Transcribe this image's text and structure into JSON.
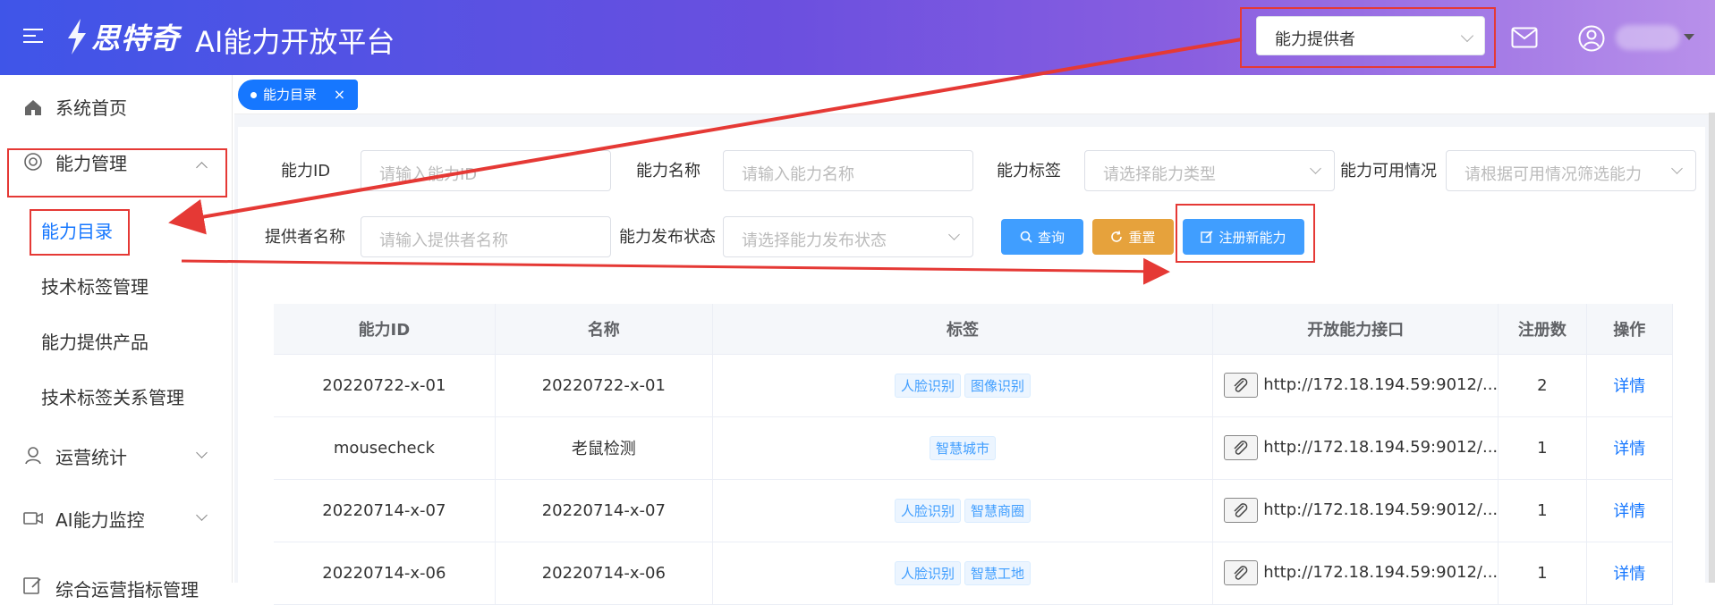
{
  "header": {
    "logo_text": "思特奇",
    "platform_title": "AI能力开放平台",
    "role_select_value": "能力提供者"
  },
  "sidebar": {
    "items": [
      {
        "label": "系统首页",
        "icon": "home-icon"
      },
      {
        "label": "能力管理",
        "icon": "capability-icon",
        "expanded": true
      },
      {
        "label": "运营统计",
        "icon": "stats-icon"
      },
      {
        "label": "AI能力监控",
        "icon": "monitor-icon"
      },
      {
        "label": "综合运营指标管理",
        "icon": "edit-icon"
      }
    ],
    "sub_items": [
      {
        "label": "能力目录",
        "active": true
      },
      {
        "label": "技术标签管理"
      },
      {
        "label": "能力提供产品"
      },
      {
        "label": "技术标签关系管理"
      }
    ]
  },
  "tabs": {
    "active_tab": "能力目录",
    "close_symbol": "×"
  },
  "filters": {
    "row1": [
      {
        "label": "能力ID",
        "placeholder": "请输入能力ID",
        "type": "input"
      },
      {
        "label": "能力名称",
        "placeholder": "请输入能力名称",
        "type": "input"
      },
      {
        "label": "能力标签",
        "placeholder": "请选择能力类型",
        "type": "select"
      },
      {
        "label": "能力可用情况",
        "placeholder": "请根据可用情况筛选能力",
        "type": "select"
      }
    ],
    "row2": [
      {
        "label": "提供者名称",
        "placeholder": "请输入提供者名称",
        "type": "input"
      },
      {
        "label": "能力发布状态",
        "placeholder": "请选择能力发布状态",
        "type": "select"
      }
    ],
    "buttons": {
      "query": "查询",
      "reset": "重置",
      "register": "注册新能力"
    }
  },
  "table": {
    "columns": [
      "能力ID",
      "名称",
      "标签",
      "开放能力接口",
      "注册数",
      "操作"
    ],
    "rows": [
      {
        "id": "20220722-x-01",
        "name": "20220722-x-01",
        "tags": [
          "人脸识别",
          "图像识别"
        ],
        "api": "http://172.18.194.59:9012/...",
        "count": "2",
        "action": "详情"
      },
      {
        "id": "mousecheck",
        "name": "老鼠检测",
        "tags": [
          "智慧城市"
        ],
        "api": "http://172.18.194.59:9012/...",
        "count": "1",
        "action": "详情"
      },
      {
        "id": "20220714-x-07",
        "name": "20220714-x-07",
        "tags": [
          "人脸识别",
          "智慧商圈"
        ],
        "api": "http://172.18.194.59:9012/...",
        "count": "1",
        "action": "详情"
      },
      {
        "id": "20220714-x-06",
        "name": "20220714-x-06",
        "tags": [
          "人脸识别",
          "智慧工地"
        ],
        "api": "http://172.18.194.59:9012/...",
        "count": "1",
        "action": "详情"
      }
    ]
  },
  "colors": {
    "primary": "#1677ff",
    "query_button": "#409eff",
    "reset_button": "#e6a23c",
    "annotation_red": "#e53935"
  }
}
